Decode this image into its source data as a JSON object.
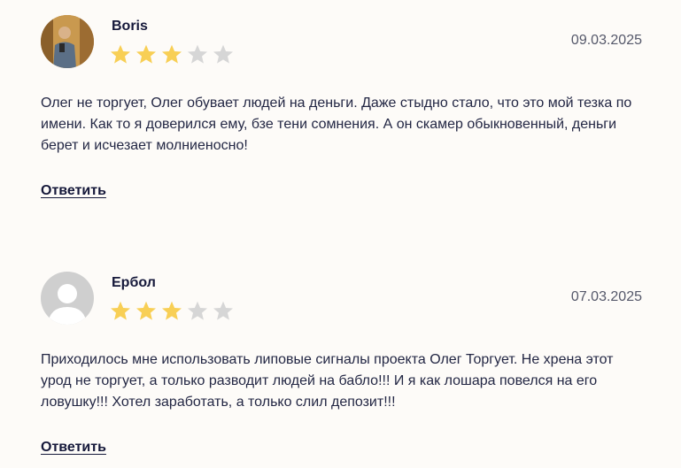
{
  "reviews": [
    {
      "author": "Boris",
      "rating": 3,
      "max_rating": 5,
      "date": "09.03.2025",
      "text": "Олег не торгует, Олег обувает людей на деньги. Даже стыдно стало, что это мой тезка по имени. Как то я доверился ему, бзе тени сомнения. А он скамер обыкновенный, деньги берет и исчезает молниеносно!",
      "reply_label": "Ответить",
      "avatar": "photo"
    },
    {
      "author": "Ербол",
      "rating": 3,
      "max_rating": 5,
      "date": "07.03.2025",
      "text": "Приходилось мне использовать липовые сигналы проекта Олег Торгует. Не хрена этот урод не торгует, а только разводит людей на бабло!!! И я как лошара повелся на его ловушку!!! Хотел заработать, а только слил депозит!!!",
      "reply_label": "Ответить",
      "avatar": "placeholder"
    }
  ],
  "colors": {
    "star_filled": "#f8cf55",
    "star_empty": "#d6d6d6",
    "text": "#232744",
    "background": "#fdfbf8"
  }
}
